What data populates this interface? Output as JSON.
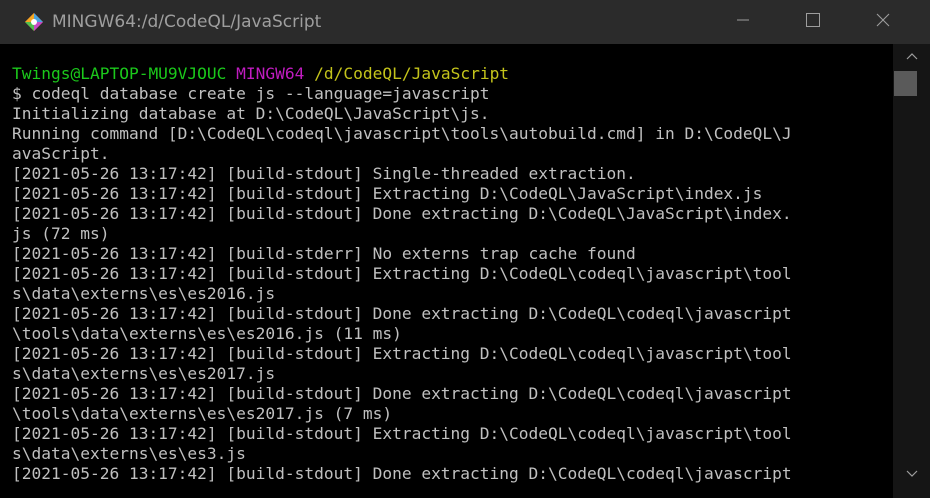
{
  "window": {
    "title": "MINGW64:/d/CodeQL/JavaScript"
  },
  "controls": {
    "minimize_icon": "minimize-icon",
    "maximize_icon": "maximize-icon",
    "close_icon": "close-icon"
  },
  "colors": {
    "prompt_user": "#1bc91b",
    "prompt_shell": "#c01cc0",
    "prompt_path": "#c4c41b",
    "output_text": "#c0c0c0",
    "background": "#000000",
    "titlebar": "#2b2b2b"
  },
  "terminal": {
    "prompt": {
      "user": "Twings@LAPTOP-MU9VJOUC",
      "shell": "MINGW64",
      "path": "/d/CodeQL/JavaScript"
    },
    "command": "$ codeql database create js --language=javascript",
    "lines": [
      "Initializing database at D:\\CodeQL\\JavaScript\\js.",
      "Running command [D:\\CodeQL\\codeql\\javascript\\tools\\autobuild.cmd] in D:\\CodeQL\\J",
      "avaScript.",
      "[2021-05-26 13:17:42] [build-stdout] Single-threaded extraction.",
      "[2021-05-26 13:17:42] [build-stdout] Extracting D:\\CodeQL\\JavaScript\\index.js",
      "[2021-05-26 13:17:42] [build-stdout] Done extracting D:\\CodeQL\\JavaScript\\index.",
      "js (72 ms)",
      "[2021-05-26 13:17:42] [build-stderr] No externs trap cache found",
      "[2021-05-26 13:17:42] [build-stdout] Extracting D:\\CodeQL\\codeql\\javascript\\tool",
      "s\\data\\externs\\es\\es2016.js",
      "[2021-05-26 13:17:42] [build-stdout] Done extracting D:\\CodeQL\\codeql\\javascript",
      "\\tools\\data\\externs\\es\\es2016.js (11 ms)",
      "[2021-05-26 13:17:42] [build-stdout] Extracting D:\\CodeQL\\codeql\\javascript\\tool",
      "s\\data\\externs\\es\\es2017.js",
      "[2021-05-26 13:17:42] [build-stdout] Done extracting D:\\CodeQL\\codeql\\javascript",
      "\\tools\\data\\externs\\es\\es2017.js (7 ms)",
      "[2021-05-26 13:17:42] [build-stdout] Extracting D:\\CodeQL\\codeql\\javascript\\tool",
      "s\\data\\externs\\es\\es3.js",
      "[2021-05-26 13:17:42] [build-stdout] Done extracting D:\\CodeQL\\codeql\\javascript"
    ]
  }
}
